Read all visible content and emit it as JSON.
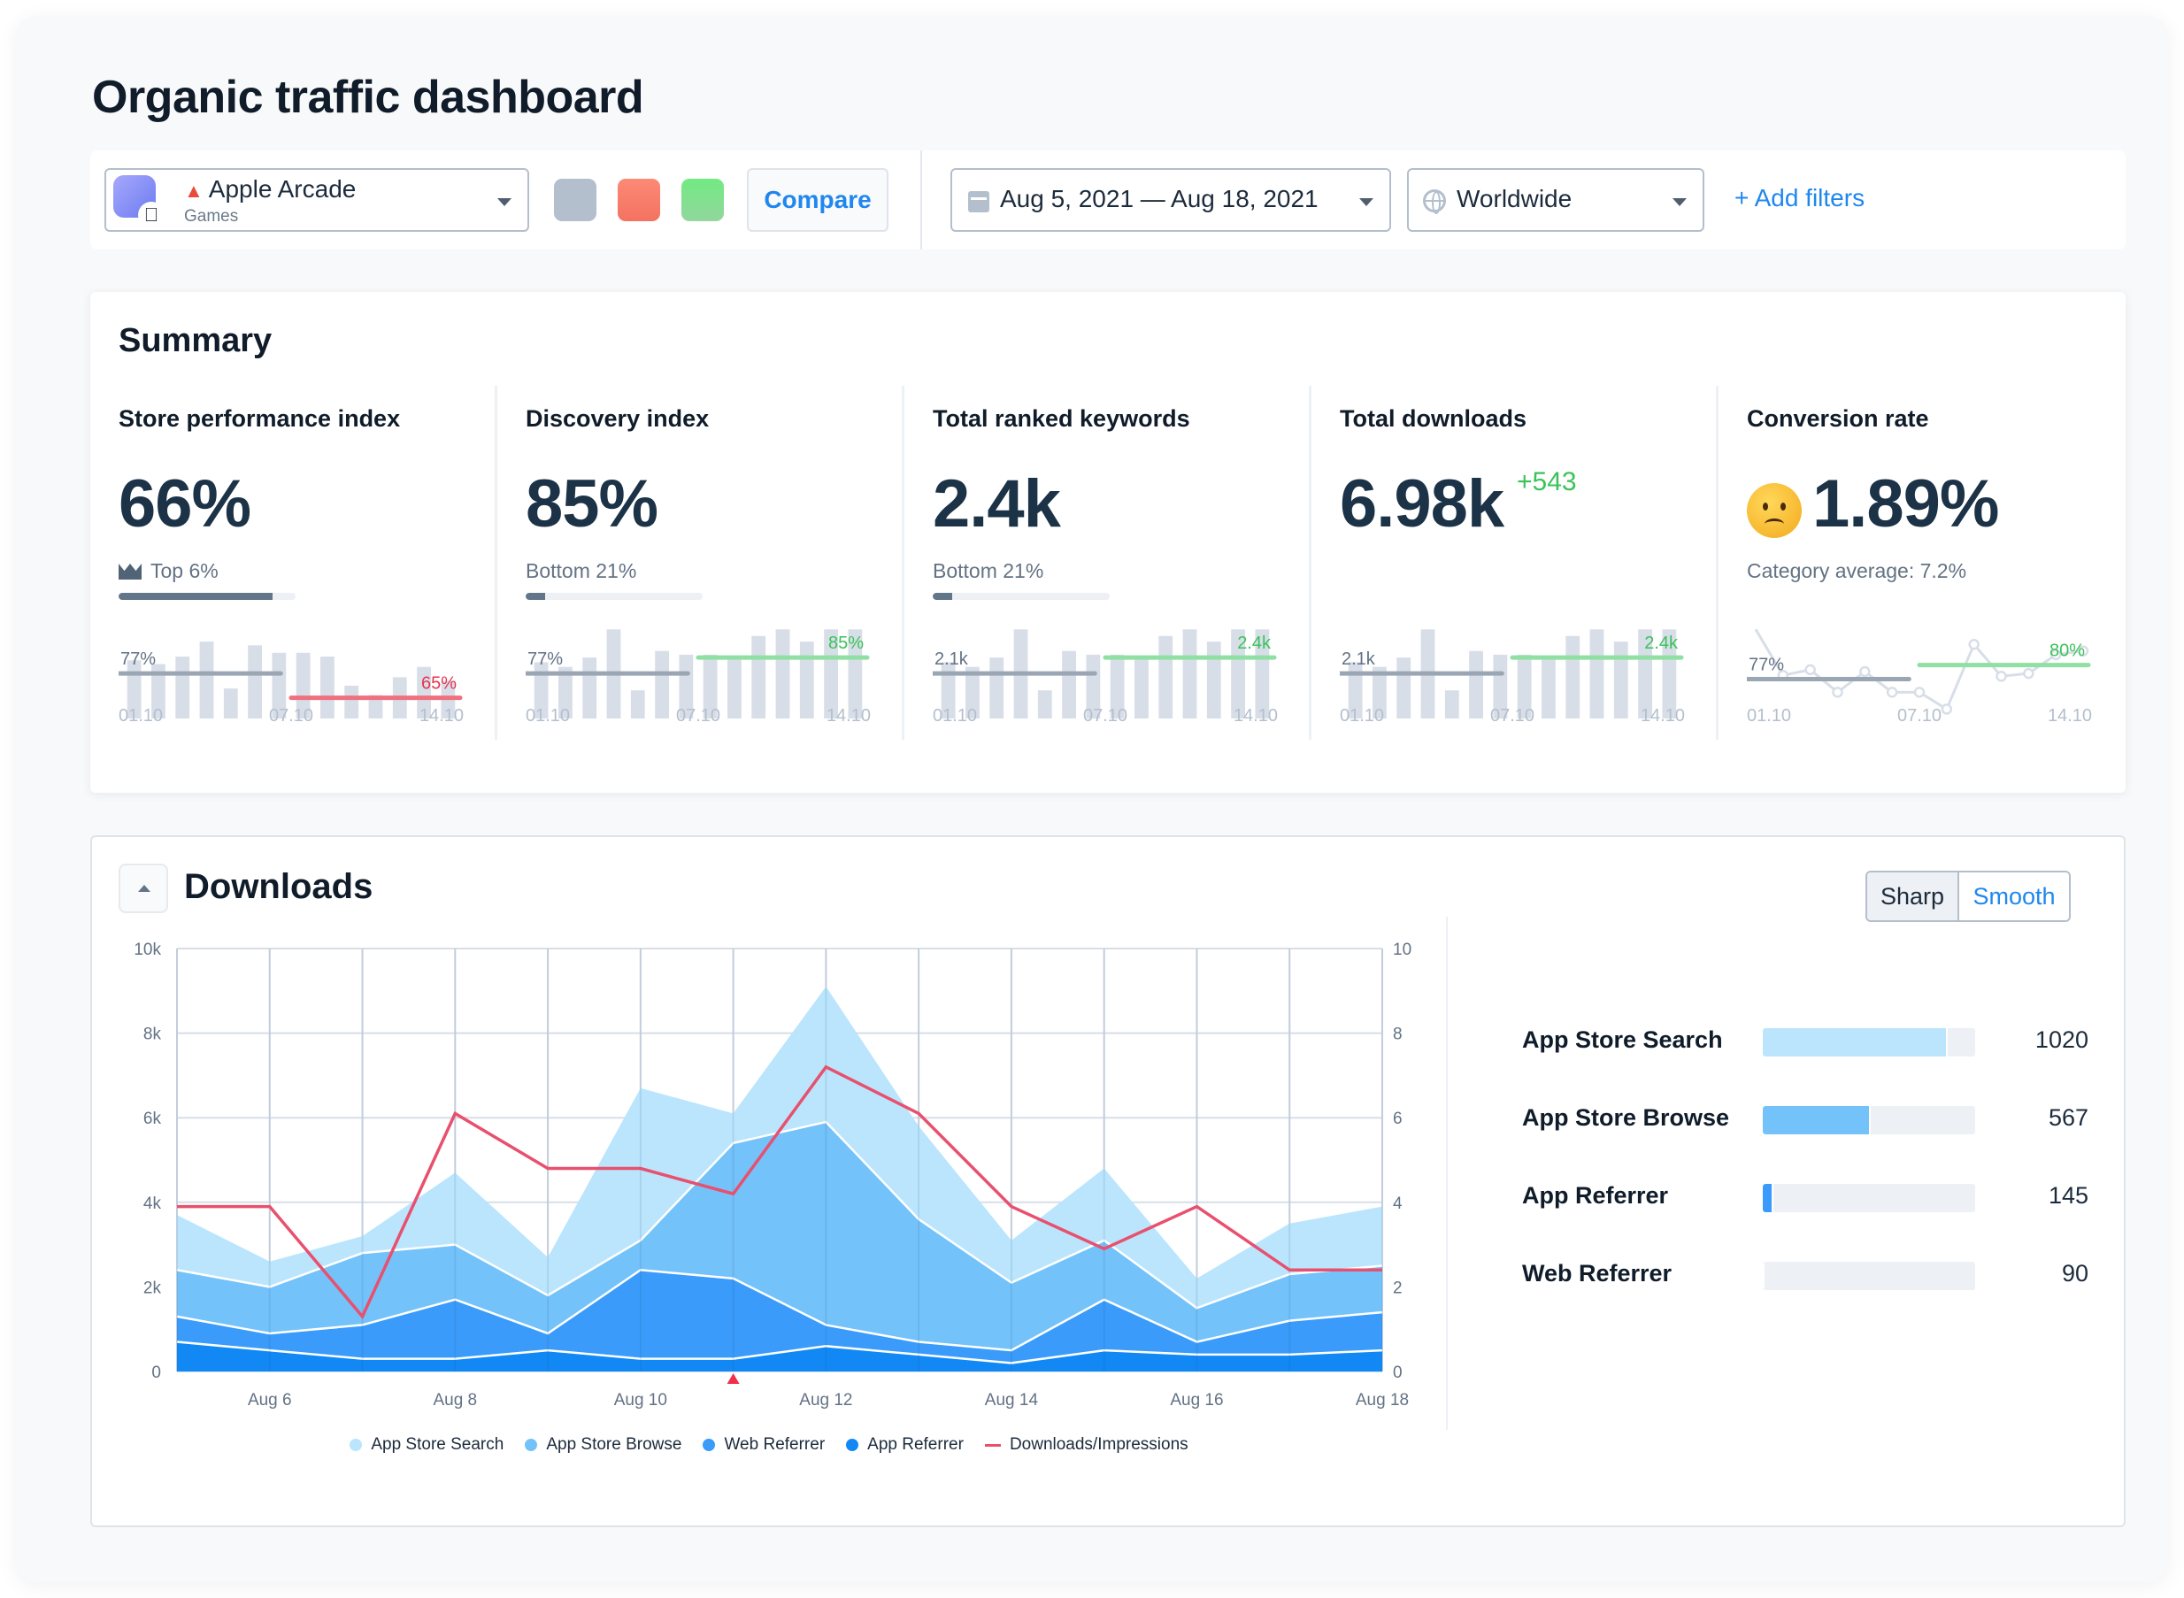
{
  "page_title": "Organic traffic dashboard",
  "toolbar": {
    "app": {
      "name": "Apple Arcade",
      "category": "Games",
      "icon": "joystick-icon",
      "platform_icon": "apple-icon"
    },
    "compare_colors": [
      "#b4bfcd",
      "#f47f6b",
      "#7fe08d"
    ],
    "compare_label": "Compare",
    "date_range": "Aug 5, 2021 — Aug 18, 2021",
    "region": "Worldwide",
    "add_filters_label": "+ Add filters"
  },
  "summary": {
    "title": "Summary",
    "metrics": [
      {
        "label": "Store performance index",
        "value": "66%",
        "sub": "Top 6%",
        "sub_icon": "crown-icon",
        "rank_fraction": 0.87,
        "spark": {
          "type": "bar",
          "values": [
            0.62,
            0.58,
            0.66,
            0.82,
            0.32,
            0.78,
            0.7,
            0.7,
            0.66,
            0.35,
            0.25,
            0.44,
            0.55,
            0.4
          ],
          "prev_label": "77%",
          "prev_level": 0.48,
          "cur_label": "65%",
          "cur_level": 0.22,
          "cur_color": "#f0707f",
          "cur_text_color": "#e8344e"
        },
        "ticks": [
          "01.10",
          "07.10",
          "14.10"
        ]
      },
      {
        "label": "Discovery index",
        "value": "85%",
        "sub": "Bottom 21%",
        "rank_fraction": 0.11,
        "spark": {
          "type": "bar",
          "values": [
            0.6,
            0.55,
            0.65,
            0.95,
            0.3,
            0.72,
            0.68,
            0.68,
            0.64,
            0.88,
            0.95,
            0.82,
            0.95,
            0.95
          ],
          "prev_label": "77%",
          "prev_level": 0.48,
          "cur_label": "85%",
          "cur_level": 0.65,
          "cur_color": "#8fe0a2",
          "cur_text_color": "#3ac35a"
        },
        "ticks": [
          "01.10",
          "07.10",
          "14.10"
        ]
      },
      {
        "label": "Total ranked keywords",
        "value": "2.4k",
        "sub": "Bottom 21%",
        "rank_fraction": 0.11,
        "spark": {
          "type": "bar",
          "values": [
            0.6,
            0.55,
            0.65,
            0.95,
            0.3,
            0.72,
            0.68,
            0.68,
            0.64,
            0.88,
            0.95,
            0.82,
            0.95,
            0.95
          ],
          "prev_label": "2.1k",
          "prev_level": 0.48,
          "cur_label": "2.4k",
          "cur_level": 0.65,
          "cur_color": "#8fe0a2",
          "cur_text_color": "#3ac35a"
        },
        "ticks": [
          "01.10",
          "07.10",
          "14.10"
        ]
      },
      {
        "label": "Total downloads",
        "value": "6.98k",
        "delta": "+543",
        "spark": {
          "type": "bar",
          "values": [
            0.6,
            0.55,
            0.65,
            0.95,
            0.3,
            0.72,
            0.68,
            0.68,
            0.64,
            0.88,
            0.95,
            0.82,
            0.95,
            0.95
          ],
          "prev_label": "2.1k",
          "prev_level": 0.48,
          "cur_label": "2.4k",
          "cur_level": 0.65,
          "cur_color": "#8fe0a2",
          "cur_text_color": "#3ac35a"
        },
        "ticks": [
          "01.10",
          "07.10",
          "14.10"
        ]
      },
      {
        "label": "Conversion rate",
        "value": "1.89%",
        "emoji": "confused-face-icon",
        "sub": "Category average: 7.2%",
        "spark": {
          "type": "line",
          "values": [
            0.95,
            0.46,
            0.52,
            0.28,
            0.5,
            0.28,
            0.28,
            0.1,
            0.79,
            0.45,
            0.48,
            0.68,
            0.72
          ],
          "prev_label": "77%",
          "prev_level": 0.42,
          "cur_label": "80%",
          "cur_level": 0.57,
          "cur_color": "#8fe0a2",
          "cur_text_color": "#3ac35a"
        },
        "ticks": [
          "01.10",
          "07.10",
          "14.10"
        ]
      }
    ]
  },
  "downloads": {
    "title": "Downloads",
    "toggle": {
      "sharp": "Sharp",
      "smooth": "Smooth",
      "selected": "Smooth"
    },
    "sources": [
      {
        "label": "App Store Search",
        "value": "1020",
        "fraction": 0.87,
        "color": "#bae5fd"
      },
      {
        "label": "App Store Browse",
        "value": "567",
        "fraction": 0.51,
        "color": "#74c2fa"
      },
      {
        "label": "App Referrer",
        "value": "145",
        "fraction": 0.05,
        "color": "#3a9bfa"
      },
      {
        "label": "Web Referrer",
        "value": "90",
        "fraction": 0.01,
        "color": "#1288f5"
      }
    ]
  },
  "chart_data": {
    "type": "area",
    "stacked": true,
    "title": "Downloads",
    "x": [
      "Aug 5",
      "Aug 6",
      "Aug 7",
      "Aug 8",
      "Aug 9",
      "Aug 10",
      "Aug 11",
      "Aug 12",
      "Aug 13",
      "Aug 14",
      "Aug 15",
      "Aug 16",
      "Aug 17",
      "Aug 18"
    ],
    "x_tick_labels": [
      "Aug 6",
      "Aug 8",
      "Aug 10",
      "Aug 12",
      "Aug 14",
      "Aug 16",
      "Aug 18"
    ],
    "y_left": {
      "ticks": [
        "0",
        "2k",
        "4k",
        "6k",
        "8k",
        "10k"
      ],
      "range": [
        0,
        10000
      ]
    },
    "y_right": {
      "ticks": [
        "0",
        "2",
        "4",
        "6",
        "8",
        "10"
      ],
      "range": [
        0,
        10
      ]
    },
    "grid": true,
    "legend_position": "bottom",
    "marker": {
      "x": "Aug 11",
      "color": "#f0304a"
    },
    "series": [
      {
        "name": "App Referrer",
        "color": "#1288f5",
        "values": [
          700,
          500,
          300,
          300,
          500,
          300,
          300,
          600,
          400,
          200,
          500,
          400,
          400,
          500
        ]
      },
      {
        "name": "Web Referrer",
        "color": "#3a9bfa",
        "values": [
          600,
          400,
          800,
          1400,
          400,
          2100,
          1900,
          500,
          300,
          300,
          1200,
          300,
          800,
          900
        ]
      },
      {
        "name": "App Store Browse",
        "color": "#74c2fa",
        "values": [
          1100,
          1100,
          1700,
          1300,
          900,
          700,
          3200,
          4800,
          2900,
          1600,
          1400,
          800,
          1100,
          1100
        ]
      },
      {
        "name": "App Store Search",
        "color": "#bae5fd",
        "values": [
          1300,
          600,
          400,
          1700,
          900,
          3600,
          700,
          3200,
          2200,
          1000,
          1700,
          700,
          1200,
          1400
        ]
      },
      {
        "name": "Downloads/Impressions",
        "type": "line",
        "axis": "right",
        "color": "#e8506e",
        "values": [
          3.9,
          3.9,
          1.3,
          6.1,
          4.8,
          4.8,
          4.2,
          7.2,
          6.1,
          3.9,
          2.9,
          3.9,
          2.4,
          2.4
        ]
      }
    ],
    "legend": [
      "App Store Search",
      "App Store Browse",
      "Web Referrer",
      "App Referrer",
      "Downloads/Impressions"
    ]
  }
}
